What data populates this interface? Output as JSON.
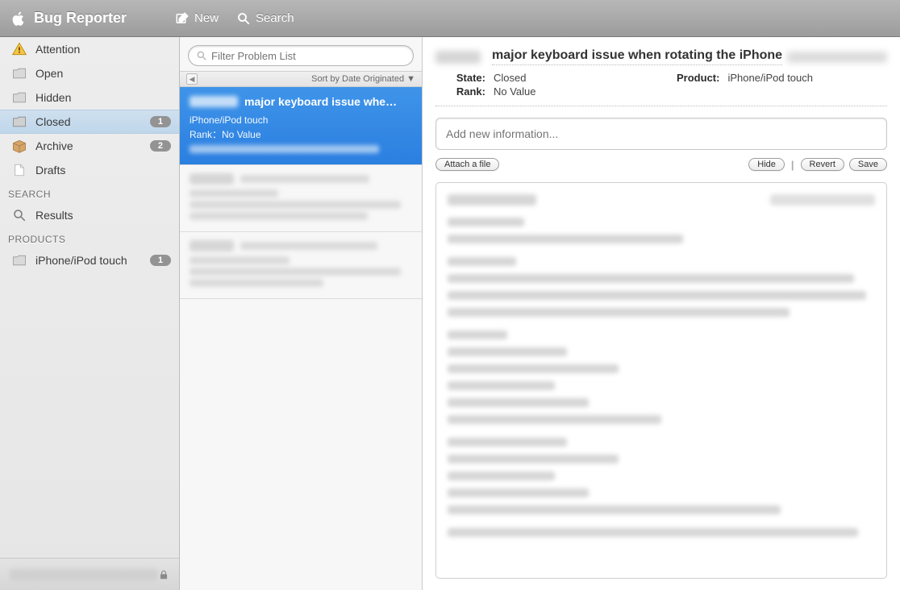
{
  "toolbar": {
    "title": "Bug Reporter",
    "new_label": "New",
    "search_label": "Search"
  },
  "sidebar": {
    "items": [
      {
        "label": "Attention",
        "icon": "attention",
        "badge": null
      },
      {
        "label": "Open",
        "icon": "folder",
        "badge": null
      },
      {
        "label": "Hidden",
        "icon": "folder",
        "badge": null
      },
      {
        "label": "Closed",
        "icon": "folder",
        "badge": "1",
        "selected": true
      },
      {
        "label": "Archive",
        "icon": "box",
        "badge": "2"
      },
      {
        "label": "Drafts",
        "icon": "doc",
        "badge": null
      }
    ],
    "search_header": "SEARCH",
    "results_label": "Results",
    "products_header": "PRODUCTS",
    "product_item": {
      "label": "iPhone/iPod touch",
      "badge": "1"
    }
  },
  "middle": {
    "filter_placeholder": "Filter Problem List",
    "sort_label": "Sort by Date Originated ▼",
    "items": [
      {
        "title": "major keyboard issue whe…",
        "sub1": "iPhone/iPod touch",
        "sub2": "Rank：No Value",
        "selected": true
      },
      {
        "blurred": true
      },
      {
        "blurred": true
      }
    ]
  },
  "detail": {
    "title": "major keyboard issue when rotating the iPhone",
    "meta": {
      "state_label": "State:",
      "state_value": "Closed",
      "product_label": "Product:",
      "product_value": "iPhone/iPod touch",
      "rank_label": "Rank:",
      "rank_value": "No Value"
    },
    "info_placeholder": "Add new information...",
    "buttons": {
      "attach": "Attach a file",
      "hide": "Hide",
      "revert": "Revert",
      "save": "Save"
    }
  }
}
